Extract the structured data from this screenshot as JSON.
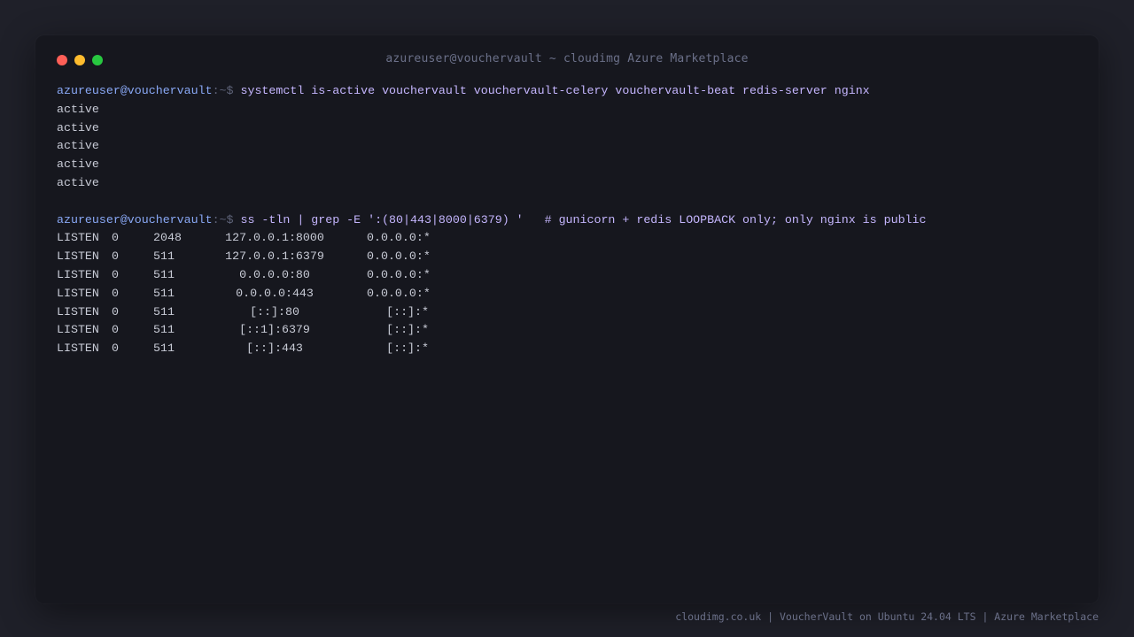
{
  "window": {
    "title": "azureuser@vouchervault ~ cloudimg Azure Marketplace",
    "controls": {
      "close_color": "#ff5f57",
      "minimize_color": "#febc2e",
      "maximize_color": "#28c840"
    }
  },
  "terminal": {
    "prompt_user": "azureuser@vouchervault",
    "prompt_path": ":~$ ",
    "command1": "systemctl is-active vouchervault vouchervault-celery vouchervault-beat redis-server nginx",
    "command1_output": [
      "active",
      "active",
      "active",
      "active",
      "active"
    ],
    "command2": "ss -tln | grep -E ':(80|443|8000|6379) '",
    "command2_comment": "   # gunicorn + redis LOOPBACK only; only nginx is public",
    "listen_rows": [
      {
        "state": "LISTEN",
        "recvq": "0",
        "sendq": "2048",
        "local": "127.0.0.1:8000",
        "peer": "0.0.0.0:*"
      },
      {
        "state": "LISTEN",
        "recvq": "0",
        "sendq": "511",
        "local": "127.0.0.1:6379",
        "peer": "0.0.0.0:*"
      },
      {
        "state": "LISTEN",
        "recvq": "0",
        "sendq": "511",
        "local": "0.0.0.0:80",
        "peer": "0.0.0.0:*"
      },
      {
        "state": "LISTEN",
        "recvq": "0",
        "sendq": "511",
        "local": "0.0.0.0:443",
        "peer": "0.0.0.0:*"
      },
      {
        "state": "LISTEN",
        "recvq": "0",
        "sendq": "511",
        "local": "[::]:80",
        "peer": "[::]:*"
      },
      {
        "state": "LISTEN",
        "recvq": "0",
        "sendq": "511",
        "local": "[::1]:6379",
        "peer": "[::]:*"
      },
      {
        "state": "LISTEN",
        "recvq": "0",
        "sendq": "511",
        "local": "[::]:443",
        "peer": "[::]:*"
      }
    ]
  },
  "footer": {
    "text": "cloudimg.co.uk | VoucherVault on Ubuntu 24.04 LTS | Azure Marketplace"
  },
  "colors": {
    "background": "#1f2029",
    "terminal_bg": "#16171e",
    "prompt_user": "#89a8f5",
    "command": "#c4b5fd",
    "output": "#c8cbd6",
    "muted": "#6b7089"
  }
}
